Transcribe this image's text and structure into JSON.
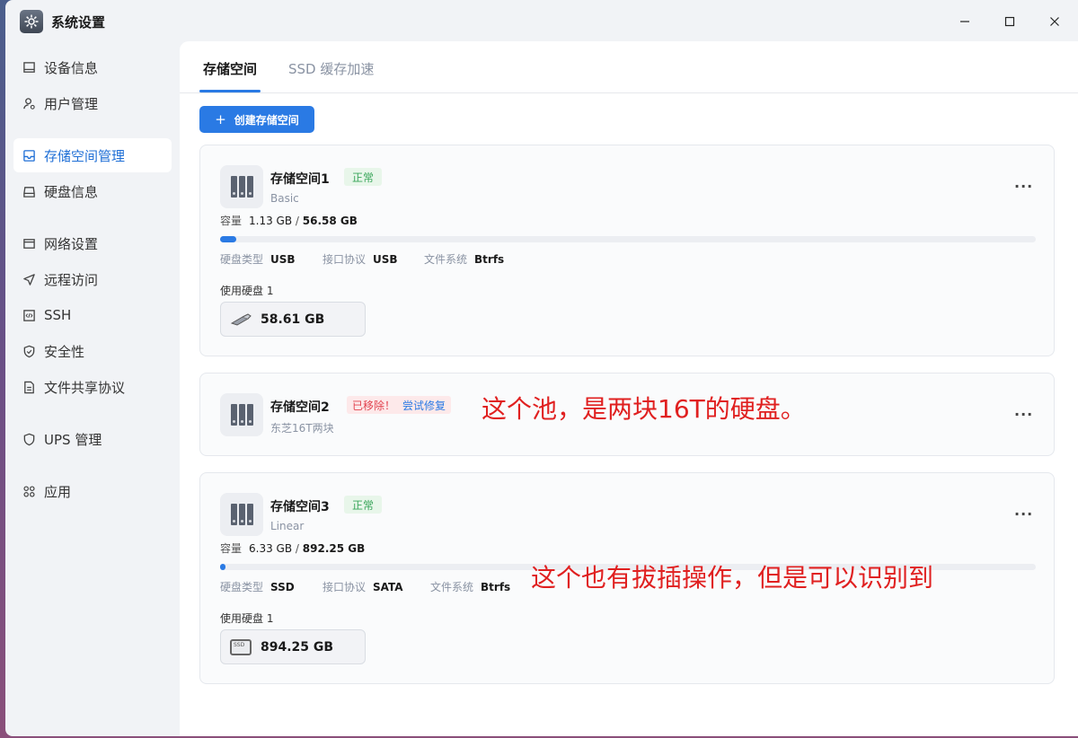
{
  "window": {
    "title": "系统设置",
    "controls": {
      "minimize": "—",
      "maximize": "☐",
      "close": "✕"
    }
  },
  "sidebar": {
    "items": [
      {
        "label": "设备信息",
        "icon": "monitor-icon",
        "active": false
      },
      {
        "label": "用户管理",
        "icon": "user-icon",
        "active": false
      },
      {
        "label": "存储空间管理",
        "icon": "storage-icon",
        "active": true
      },
      {
        "label": "硬盘信息",
        "icon": "disk-icon",
        "active": false
      },
      {
        "label": "网络设置",
        "icon": "network-icon",
        "active": false
      },
      {
        "label": "远程访问",
        "icon": "send-icon",
        "active": false
      },
      {
        "label": "SSH",
        "icon": "code-icon",
        "active": false
      },
      {
        "label": "安全性",
        "icon": "shield-icon",
        "active": false
      },
      {
        "label": "文件共享协议",
        "icon": "file-icon",
        "active": false
      },
      {
        "label": "UPS 管理",
        "icon": "ups-shield-icon",
        "active": false
      },
      {
        "label": "应用",
        "icon": "apps-icon",
        "active": false
      }
    ]
  },
  "main": {
    "tabs": [
      {
        "label": "存储空间",
        "active": true
      },
      {
        "label": "SSD 缓存加速",
        "active": false
      }
    ],
    "create_button": {
      "icon": "+",
      "label": "创建存储空间"
    },
    "pools": [
      {
        "name": "存储空间1",
        "status": "正常",
        "raid": "Basic",
        "capacity_label": "容量",
        "used": "1.13 GB",
        "total": "56.58 GB",
        "usage_fraction": 0.02,
        "disk_type_label": "硬盘类型",
        "disk_type": "USB",
        "interface_label": "接口协议",
        "interface": "USB",
        "fs_label": "文件系统",
        "fs": "Btrfs",
        "used_disks_label": "使用硬盘 1",
        "disk_size": "58.61 GB",
        "disk_icon": "usb-drive-icon"
      },
      {
        "name": "存储空间2",
        "status_removed": "已移除！",
        "repair_label": "尝试修复",
        "description": "东芝16T两块"
      },
      {
        "name": "存储空间3",
        "status": "正常",
        "raid": "Linear",
        "capacity_label": "容量",
        "used": "6.33 GB",
        "total": "892.25 GB",
        "usage_fraction": 0.007,
        "disk_type_label": "硬盘类型",
        "disk_type": "SSD",
        "interface_label": "接口协议",
        "interface": "SATA",
        "fs_label": "文件系统",
        "fs": "Btrfs",
        "used_disks_label": "使用硬盘 1",
        "disk_size": "894.25 GB",
        "disk_icon": "ssd-icon"
      }
    ],
    "more_label": "···"
  },
  "annotations": {
    "pool2": "这个池，是两块16T的硬盘。",
    "pool3": "这个也有拔插操作，但是可以识别到"
  },
  "colors": {
    "accent": "#2a7ae4",
    "ok": "#3aa65b",
    "error": "#e2434f",
    "annotation": "#e02020"
  }
}
